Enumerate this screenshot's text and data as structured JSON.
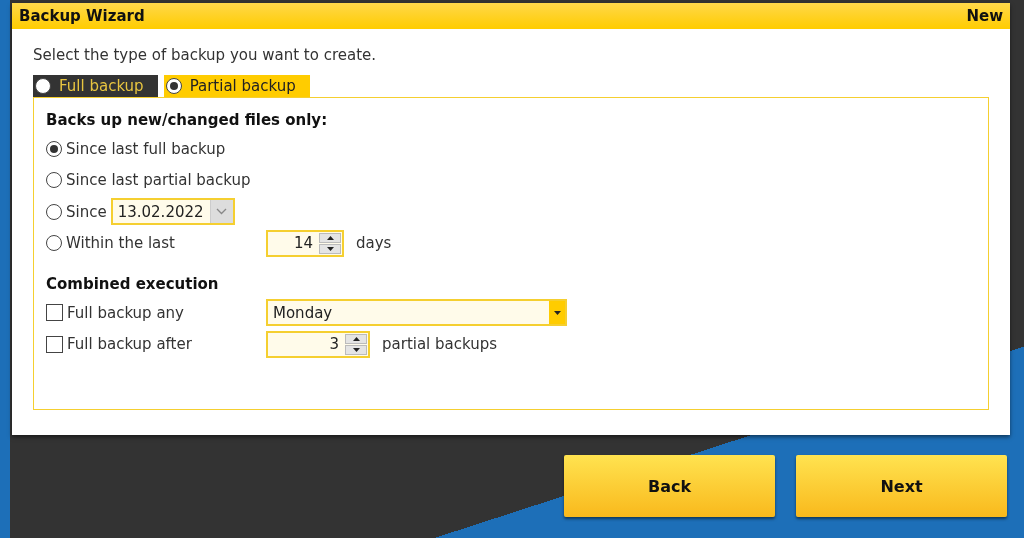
{
  "window": {
    "title": "Backup Wizard",
    "mode": "New"
  },
  "instruction": "Select the type of backup you want to create.",
  "tabs": [
    {
      "label": "Full backup",
      "selected": false
    },
    {
      "label": "Partial backup",
      "selected": true
    }
  ],
  "since_section": {
    "heading": "Backs up new/changed files only:",
    "options": [
      {
        "kind": "plain",
        "label": "Since last full backup",
        "selected": true
      },
      {
        "kind": "plain",
        "label": "Since last partial backup",
        "selected": false
      },
      {
        "kind": "date",
        "label": "Since",
        "selected": false,
        "value": "13.02.2022"
      },
      {
        "kind": "spin",
        "label": "Within the last",
        "selected": false,
        "value": "14",
        "unit": "days"
      }
    ]
  },
  "combined_section": {
    "heading": "Combined execution",
    "options": [
      {
        "kind": "dropdown",
        "label": "Full backup any",
        "checked": false,
        "value": "Monday"
      },
      {
        "kind": "spin",
        "label": "Full backup after",
        "checked": false,
        "value": "3",
        "unit": "partial backups"
      }
    ]
  },
  "buttons": [
    "Back",
    "Next"
  ]
}
